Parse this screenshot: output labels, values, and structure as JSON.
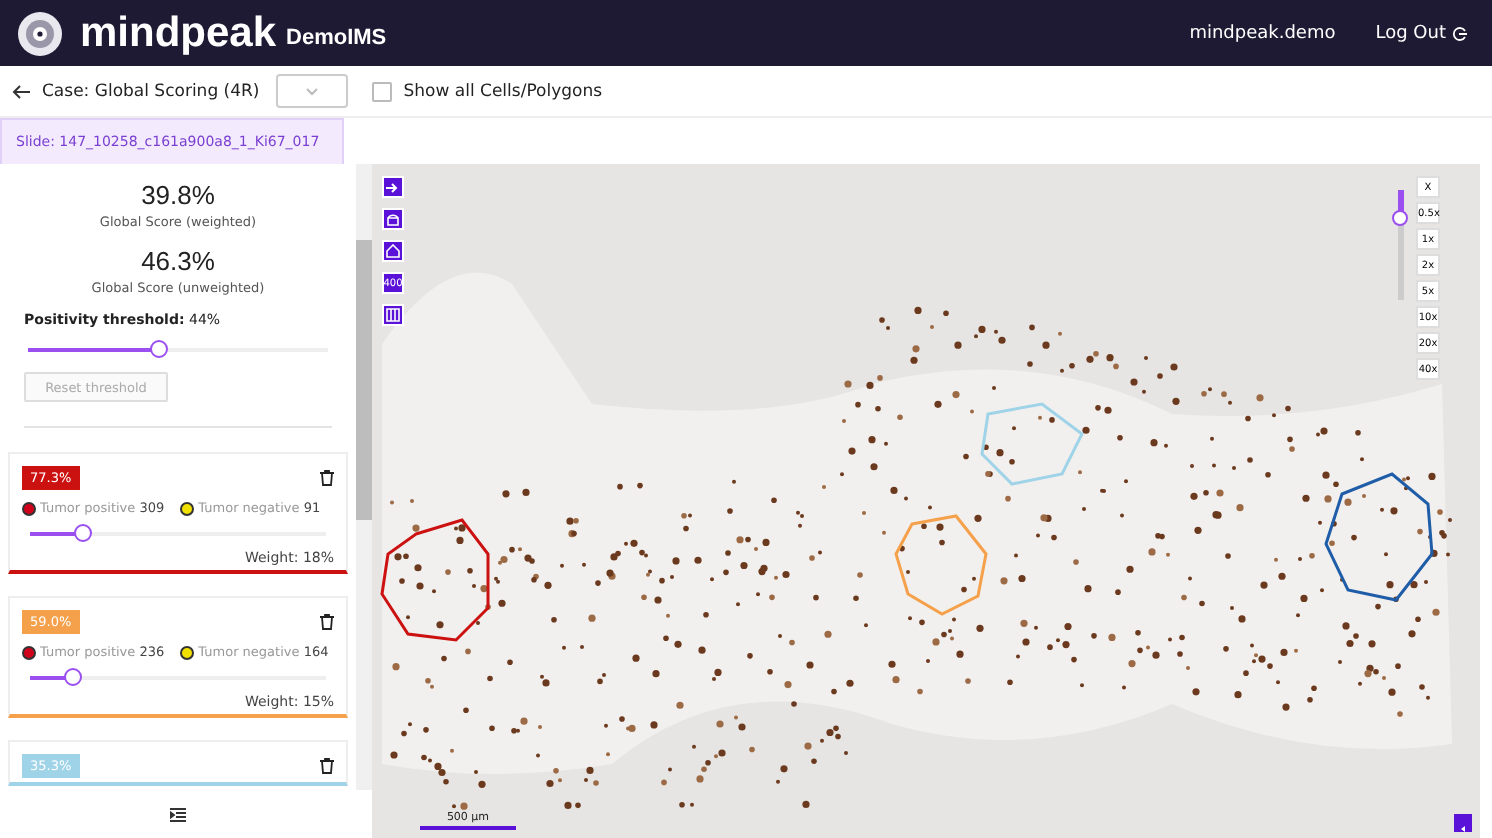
{
  "header": {
    "logo_text": "mindpeak",
    "product": "DemoIMS",
    "user": "mindpeak.demo",
    "logout": "Log Out"
  },
  "toolbar": {
    "case_label": "Case: Global Scoring (4R)",
    "show_all": {
      "label": "Show all Cells/Polygons",
      "checked": false
    }
  },
  "slide_tab": {
    "label": "Slide: 147_10258_c161a900a8_1_Ki67_017",
    "selected": true
  },
  "summary": {
    "scores": [
      {
        "value": "39.8%",
        "label": "Global Score (weighted)"
      },
      {
        "value": "46.3%",
        "label": "Global Score (unweighted)"
      }
    ],
    "threshold": {
      "label": "Positivity threshold:",
      "value": "44%",
      "level": 0.44
    },
    "reset_button": {
      "label": "Reset threshold",
      "disabled": true
    }
  },
  "regions": [
    {
      "score": "77.3%",
      "color": "#cc1111",
      "positive_label": "Tumor positive",
      "positive_count": "309",
      "negative_label": "Tumor negative",
      "negative_count": "91",
      "level": 0.18,
      "weight": "Weight: 18%"
    },
    {
      "score": "59.0%",
      "color": "#f5a04a",
      "positive_label": "Tumor positive",
      "positive_count": "236",
      "negative_label": "Tumor negative",
      "negative_count": "164",
      "level": 0.15,
      "weight": "Weight: 15%"
    },
    {
      "score": "35.3%",
      "color": "#9fd3e8"
    }
  ],
  "viewer": {
    "tools": [
      {
        "kind": "arrow"
      },
      {
        "kind": "rotate"
      },
      {
        "kind": "home"
      },
      {
        "kind": "text",
        "label": "400"
      },
      {
        "kind": "columns"
      }
    ],
    "zoom": {
      "close": "X",
      "level": 0.25,
      "buttons": [
        "0.5x",
        "1x",
        "2x",
        "5x",
        "10x",
        "20x",
        "40x"
      ]
    },
    "scale_bar": "500 µm"
  }
}
